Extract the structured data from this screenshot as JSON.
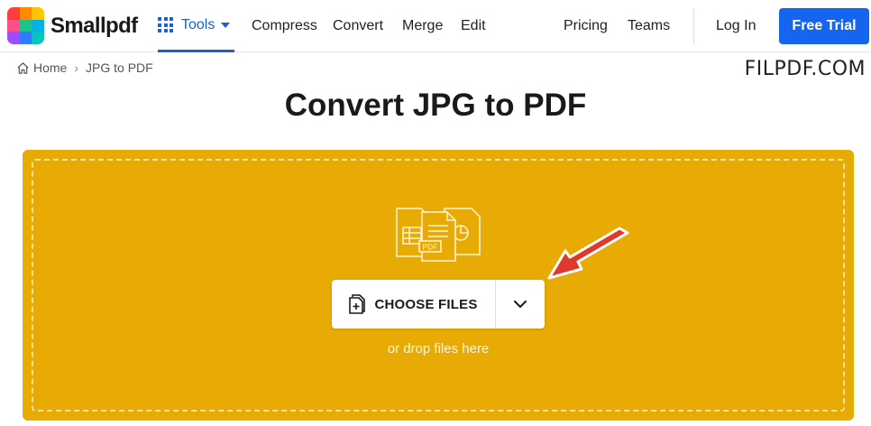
{
  "brand": {
    "name": "Smallpdf",
    "logo_colors": [
      "#ff3d3d",
      "#ff8a00",
      "#ffc400",
      "#ff4f8b",
      "#1ec28b",
      "#00b3e6",
      "#9b4dff",
      "#2f7bff",
      "#00c7b7"
    ]
  },
  "nav": {
    "tools_label": "Tools",
    "items": [
      "Compress",
      "Convert",
      "Merge",
      "Edit"
    ],
    "pricing": "Pricing",
    "teams": "Teams",
    "login": "Log In",
    "trial": "Free Trial",
    "accent_color": "#1e5fd1",
    "trial_color": "#1565f0"
  },
  "breadcrumb": {
    "home": "Home",
    "current": "JPG to PDF"
  },
  "watermark": "FILPDF.COM",
  "title": "Convert JPG to PDF",
  "upload": {
    "button_label": "CHOOSE FILES",
    "hint": "or drop files here",
    "icon_badge": "PDF",
    "zone_color": "#e8aa05"
  },
  "icons": {
    "tools": "grid-icon",
    "tools_caret": "caret-down-icon",
    "home": "home-icon",
    "upload": "file-plus-icon",
    "dropdown": "chevron-down-icon",
    "files": "documents-icon",
    "pointer": "red-arrow-icon"
  }
}
